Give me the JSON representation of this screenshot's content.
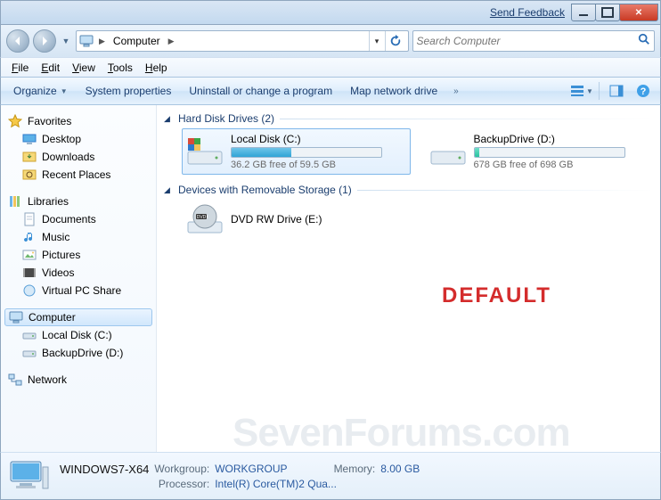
{
  "titlebar": {
    "feedback": "Send Feedback"
  },
  "nav": {
    "breadcrumb": {
      "root_icon": "computer-icon",
      "segment": "Computer"
    },
    "search_placeholder": "Search Computer"
  },
  "menu": {
    "file": "File",
    "edit": "Edit",
    "view": "View",
    "tools": "Tools",
    "help": "Help"
  },
  "cmd": {
    "organize": "Organize",
    "sysprops": "System properties",
    "uninstall": "Uninstall or change a program",
    "mapdrive": "Map network drive"
  },
  "sidebar": {
    "favorites": {
      "label": "Favorites",
      "items": [
        "Desktop",
        "Downloads",
        "Recent Places"
      ]
    },
    "libraries": {
      "label": "Libraries",
      "items": [
        "Documents",
        "Music",
        "Pictures",
        "Videos",
        "Virtual PC Share"
      ]
    },
    "computer": {
      "label": "Computer",
      "items": [
        "Local Disk (C:)",
        "BackupDrive (D:)"
      ]
    },
    "network": {
      "label": "Network"
    }
  },
  "content": {
    "hdd_header": "Hard Disk Drives (2)",
    "removable_header": "Devices with Removable Storage (1)",
    "drives": [
      {
        "name": "Local Disk (C:)",
        "free_text": "36.2 GB free of 59.5 GB",
        "fill_pct": 40,
        "fill_color": "#2fa4d6",
        "selected": true
      },
      {
        "name": "BackupDrive (D:)",
        "free_text": "678 GB free of 698 GB",
        "fill_pct": 3,
        "fill_color": "#29c2a0",
        "selected": false
      }
    ],
    "removable": [
      {
        "name": "DVD RW Drive (E:)"
      }
    ],
    "overlay_text": "DEFAULT",
    "watermark": "SevenForums.com"
  },
  "details": {
    "name": "WINDOWS7-X64",
    "workgroup_label": "Workgroup:",
    "workgroup": "WORKGROUP",
    "memory_label": "Memory:",
    "memory": "8.00 GB",
    "processor_label": "Processor:",
    "processor": "Intel(R) Core(TM)2 Qua..."
  }
}
